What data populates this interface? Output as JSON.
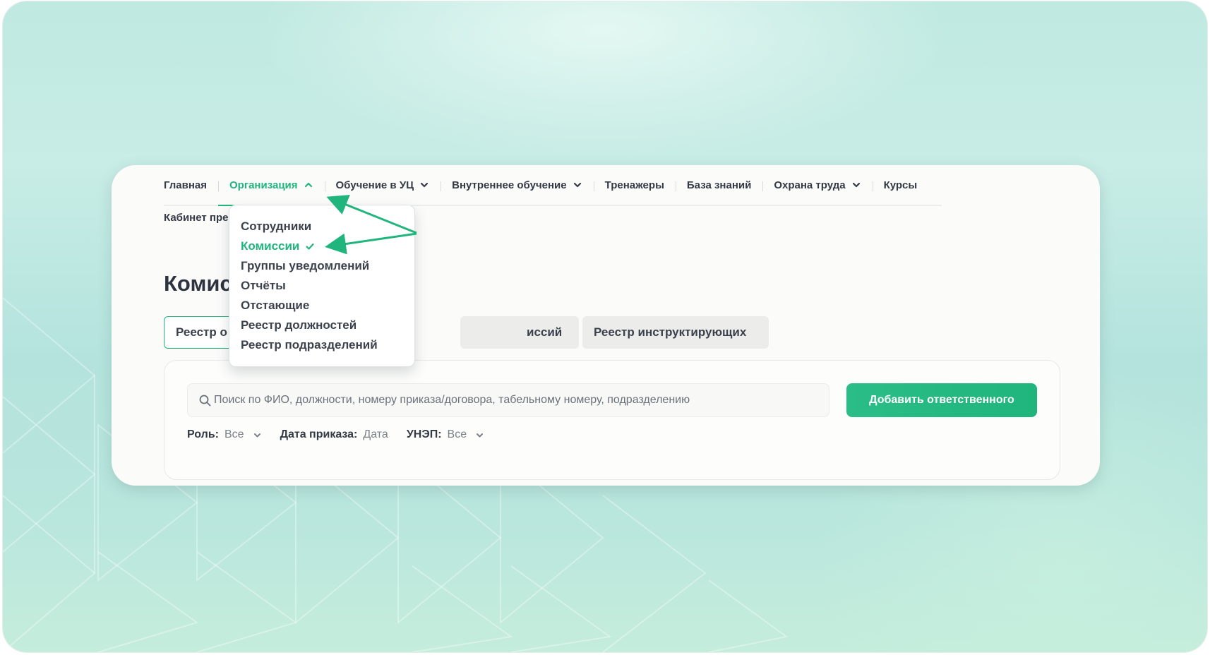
{
  "nav": {
    "items": [
      {
        "label": "Главная"
      },
      {
        "label": "Организация"
      },
      {
        "label": "Обучение в УЦ"
      },
      {
        "label": "Внутреннее обучение"
      },
      {
        "label": "Тренажеры"
      },
      {
        "label": "База знаний"
      },
      {
        "label": "Охрана труда"
      },
      {
        "label": "Курсы"
      }
    ]
  },
  "breadcrumb": "Кабинет пре",
  "page_title": "Комис",
  "tabs": [
    {
      "label": "Реестр о"
    },
    {
      "label": "иссий"
    },
    {
      "label": "Реестр инструктирующих"
    }
  ],
  "dropdown": {
    "items": [
      {
        "label": "Сотрудники"
      },
      {
        "label": "Комиссии"
      },
      {
        "label": "Группы уведомлений"
      },
      {
        "label": "Отчёты"
      },
      {
        "label": "Отстающие"
      },
      {
        "label": "Реестр должностей"
      },
      {
        "label": "Реестр подразделений"
      }
    ],
    "selected": "Комиссии"
  },
  "search": {
    "placeholder": "Поиск по ФИО, должности, номеру приказа/договора, табельному номеру, подразделению"
  },
  "add_button": "Добавить ответственного",
  "filters": {
    "role": {
      "label": "Роль:",
      "value": "Все"
    },
    "order_date": {
      "label": "Дата приказа:",
      "value": "Дата"
    },
    "unep": {
      "label": "УНЭП:",
      "value": "Все"
    }
  },
  "colors": {
    "accent": "#1fb57c",
    "annotation_arrow": "#1fb57c",
    "background": "#bfe9e1"
  }
}
